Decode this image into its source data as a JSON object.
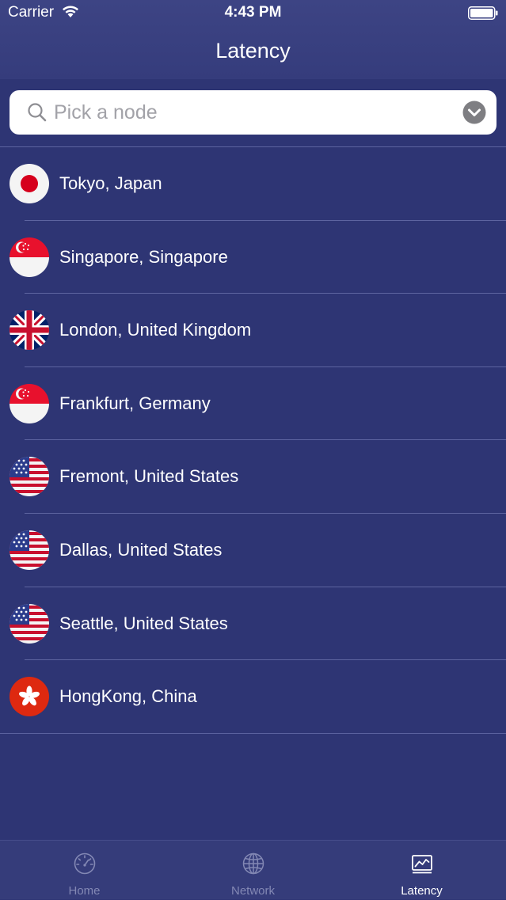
{
  "status_bar": {
    "carrier": "Carrier",
    "time": "4:43 PM"
  },
  "nav": {
    "title": "Latency"
  },
  "search": {
    "placeholder": "Pick a node"
  },
  "nodes": [
    {
      "label": "Tokyo, Japan",
      "flag": "japan-flag-icon"
    },
    {
      "label": "Singapore, Singapore",
      "flag": "singapore-flag-icon"
    },
    {
      "label": "London, United Kingdom",
      "flag": "uk-flag-icon"
    },
    {
      "label": "Frankfurt, Germany",
      "flag": "singapore-flag-icon"
    },
    {
      "label": "Fremont, United States",
      "flag": "us-flag-icon"
    },
    {
      "label": "Dallas, United States",
      "flag": "us-flag-icon"
    },
    {
      "label": "Seattle, United States",
      "flag": "us-flag-icon"
    },
    {
      "label": "HongKong, China",
      "flag": "hongkong-flag-icon"
    }
  ],
  "tabs": [
    {
      "label": "Home",
      "icon": "speedometer-icon",
      "active": false
    },
    {
      "label": "Network",
      "icon": "globe-icon",
      "active": false
    },
    {
      "label": "Latency",
      "icon": "chart-icon",
      "active": true
    }
  ],
  "colors": {
    "background": "#2e3574",
    "separator": "#5d64a0",
    "inactive_tab": "#8388b4",
    "active_tab": "#ffffff"
  }
}
